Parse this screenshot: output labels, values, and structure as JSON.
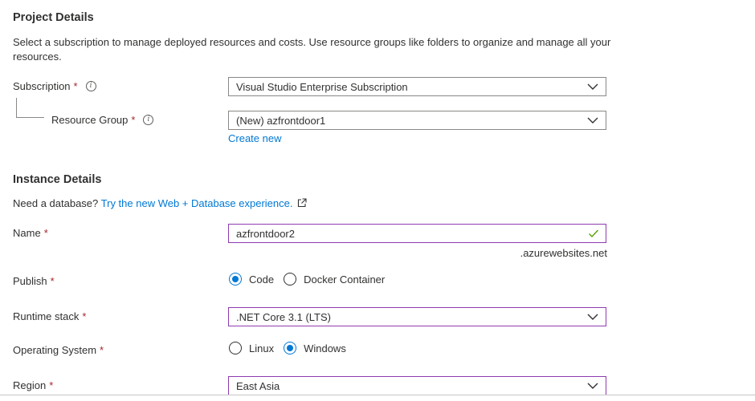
{
  "project": {
    "title": "Project Details",
    "description": "Select a subscription to manage deployed resources and costs. Use resource groups like folders to organize and manage all your resources.",
    "subscription_label": "Subscription",
    "subscription_value": "Visual Studio Enterprise Subscription",
    "resource_group_label": "Resource Group",
    "resource_group_value": "(New) azfrontdoor1",
    "create_new": "Create new"
  },
  "instance": {
    "title": "Instance Details",
    "db_prompt": "Need a database?",
    "db_link": "Try the new Web + Database experience.",
    "name_label": "Name",
    "name_value": "azfrontdoor2",
    "name_suffix": ".azurewebsites.net",
    "publish_label": "Publish",
    "publish_options": [
      "Code",
      "Docker Container"
    ],
    "publish_selected": "Code",
    "runtime_label": "Runtime stack",
    "runtime_value": ".NET Core 3.1 (LTS)",
    "os_label": "Operating System",
    "os_options": [
      "Linux",
      "Windows"
    ],
    "os_selected": "Windows",
    "region_label": "Region",
    "region_value": "East Asia"
  },
  "required_marker": "*",
  "info_icon_glyph": "i",
  "colors": {
    "accent": "#0078d4",
    "focus_border": "#8f3bb0",
    "valid_check": "#57a300",
    "required": "#a4262c"
  }
}
